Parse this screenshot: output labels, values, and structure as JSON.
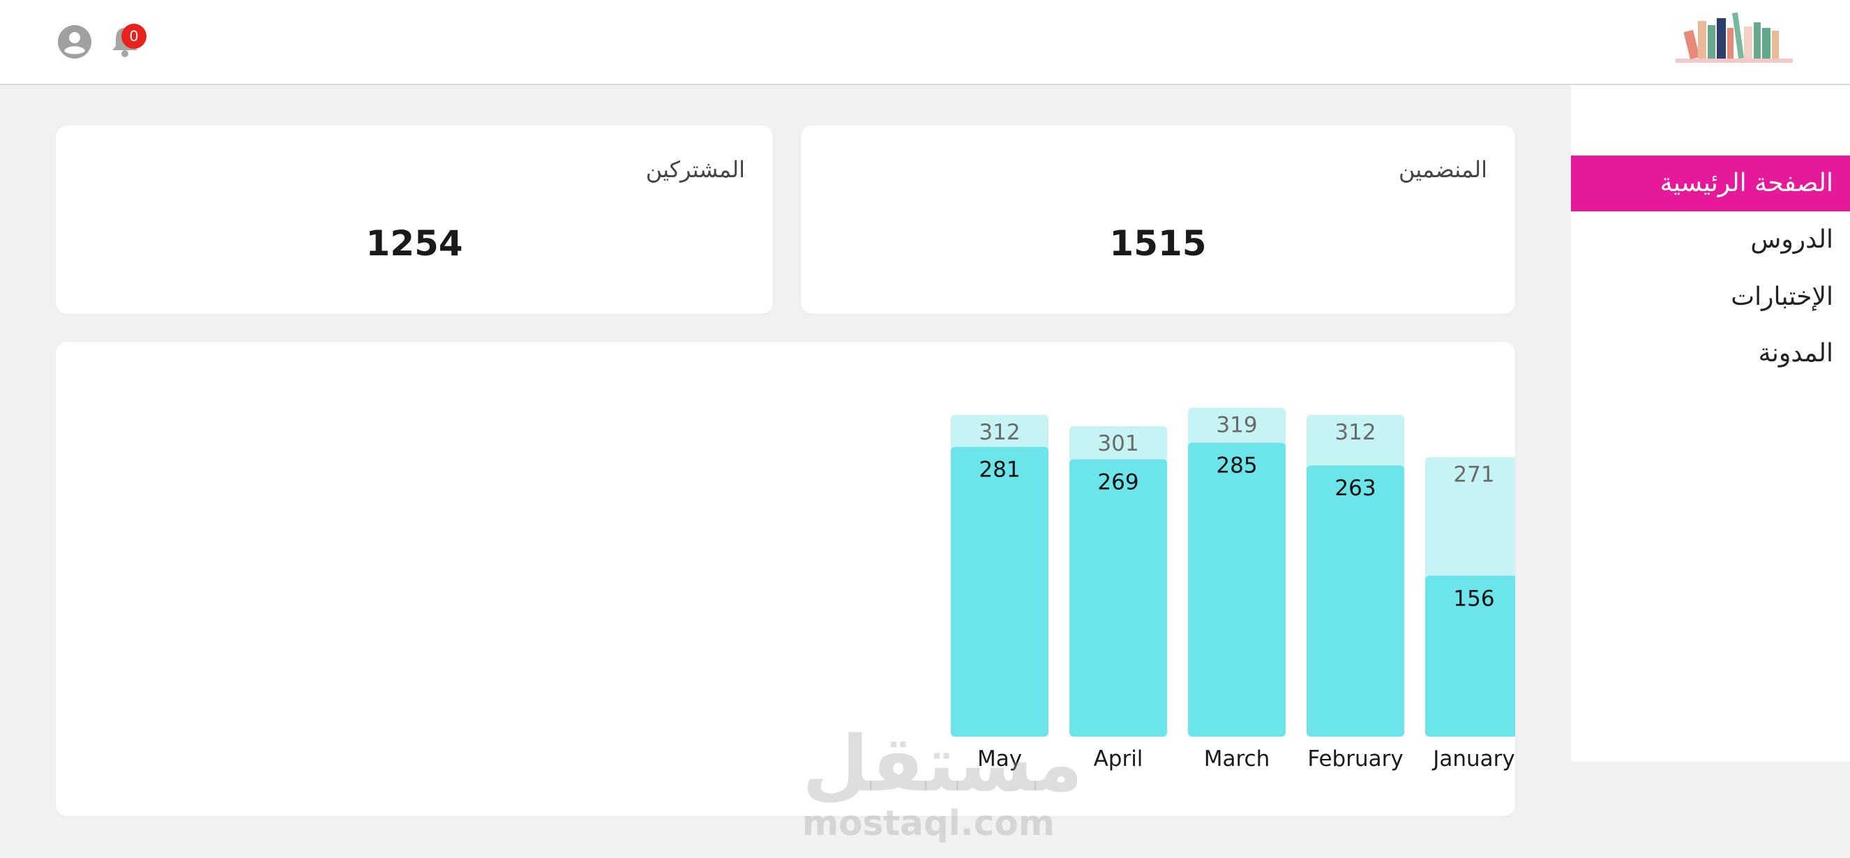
{
  "header": {
    "notification_count": "0",
    "icons": [
      "user-account-icon",
      "bell-icon",
      "books-logo"
    ]
  },
  "sidebar": {
    "items": [
      {
        "label": "الصفحة الرئيسية",
        "active": true
      },
      {
        "label": "الدروس",
        "active": false
      },
      {
        "label": "الإختبارات",
        "active": false
      },
      {
        "label": "المدونة",
        "active": false
      }
    ]
  },
  "stats": {
    "joined": {
      "title": "المنضمين",
      "value": "1515"
    },
    "subscribers": {
      "title": "المشتركين",
      "value": "1254"
    }
  },
  "chart_data": {
    "type": "bar",
    "categories": [
      "January",
      "February",
      "March",
      "April",
      "May"
    ],
    "series": [
      {
        "values": [
          271,
          312,
          319,
          301,
          312
        ]
      },
      {
        "values": [
          156,
          263,
          285,
          269,
          281
        ]
      }
    ],
    "ylim": [
      0,
      345
    ],
    "colors": {
      "back": "#c6f3f4",
      "front": "#6be4ea"
    }
  },
  "watermark": {
    "arabic": "مستقل",
    "latin": "mostaql.com"
  }
}
